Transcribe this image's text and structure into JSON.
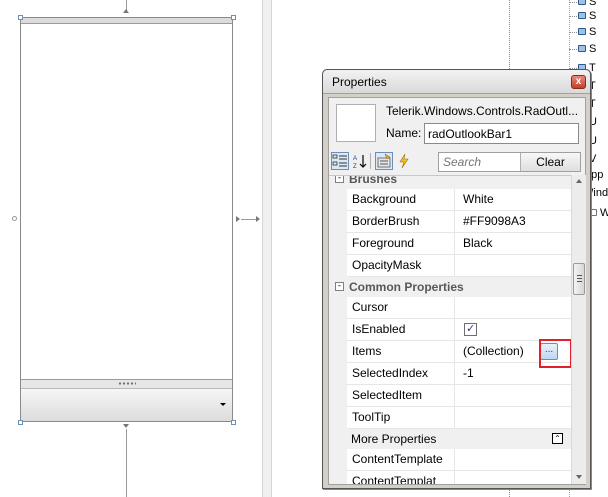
{
  "designer": {},
  "tree": {
    "items": [
      {
        "label": "S"
      },
      {
        "label": "S"
      },
      {
        "label": "S"
      },
      {
        "label": "T"
      },
      {
        "label": "T"
      },
      {
        "label": "T"
      },
      {
        "label": "U"
      },
      {
        "label": "U"
      },
      {
        "label": "V"
      },
      {
        "label": "app"
      },
      {
        "label": "Wind"
      },
      {
        "label": "W"
      }
    ]
  },
  "properties": {
    "window_title": "Properties",
    "close_glyph": "x",
    "object_type": "Telerik.Windows.Controls.RadOutl...",
    "name_label": "Name:",
    "name_value": "radOutlookBar1",
    "search_placeholder": "Search",
    "clear_label": "Clear",
    "toolbar_icons": [
      "categorized-view-icon",
      "alphabetical-sort-icon",
      "properties-view-icon",
      "events-icon"
    ],
    "categories": [
      {
        "label": "Brushes",
        "expander": "-",
        "rows": [
          {
            "name": "Background",
            "value": "White"
          },
          {
            "name": "BorderBrush",
            "value": "#FF9098A3"
          },
          {
            "name": "Foreground",
            "value": "Black"
          },
          {
            "name": "OpacityMask",
            "value": ""
          }
        ]
      },
      {
        "label": "Common Properties",
        "expander": "-",
        "rows": [
          {
            "name": "Cursor",
            "value": ""
          },
          {
            "name": "IsEnabled",
            "value": "",
            "checked": true
          },
          {
            "name": "Items",
            "value": "(Collection)",
            "button": "..."
          },
          {
            "name": "SelectedIndex",
            "value": "-1"
          },
          {
            "name": "SelectedItem",
            "value": ""
          },
          {
            "name": "ToolTip",
            "value": ""
          }
        ]
      }
    ],
    "more_properties_label": "More Properties",
    "more_rows": [
      {
        "name": "ContentTemplate",
        "value": ""
      },
      {
        "name": "ContentTemplat",
        "value": ""
      }
    ]
  }
}
